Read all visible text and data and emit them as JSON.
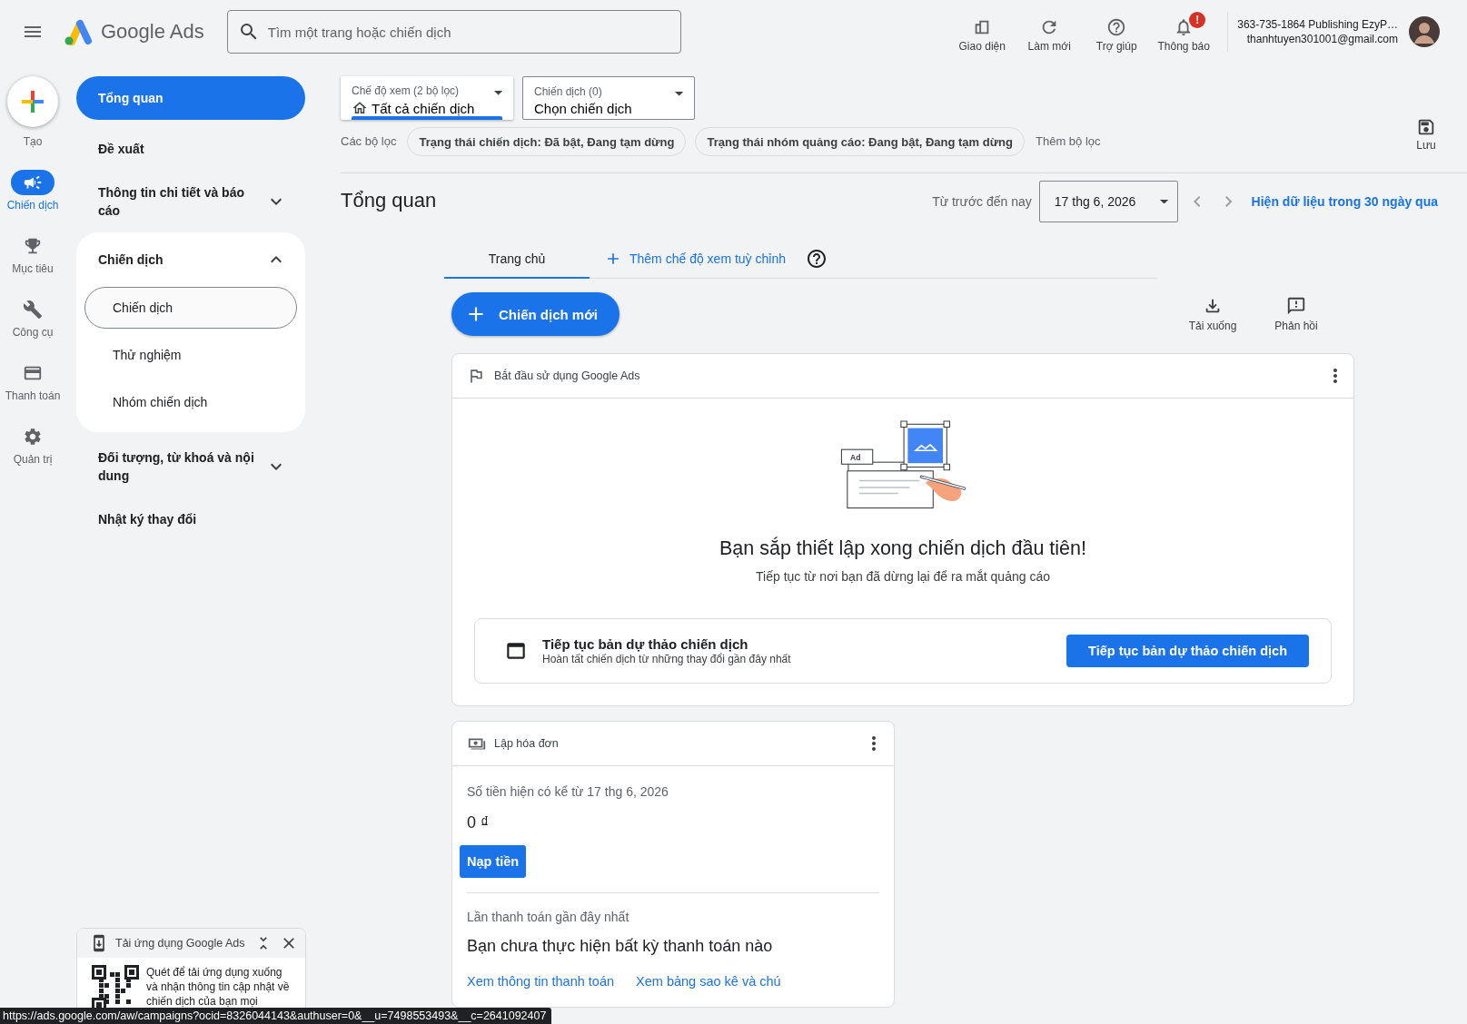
{
  "header": {
    "brand": "Google Ads",
    "search_placeholder": "Tìm một trang hoặc chiến dịch",
    "actions": [
      {
        "kind": "appearance",
        "label": "Giao diện"
      },
      {
        "kind": "refresh",
        "label": "Làm mới"
      },
      {
        "kind": "help",
        "label": "Trợ giúp"
      },
      {
        "kind": "notifications",
        "label": "Thông báo",
        "badge": "!"
      }
    ],
    "account": {
      "name": "363-735-1864 Publishing EzyP…",
      "email": "thanhtuyen301001@gmail.com"
    }
  },
  "rail": {
    "create": "Tạo",
    "items": [
      {
        "kind": "campaigns",
        "label": "Chiến dịch",
        "selected": true
      },
      {
        "kind": "goals",
        "label": "Mục tiêu",
        "selected": false
      },
      {
        "kind": "tools",
        "label": "Công cụ",
        "selected": false
      },
      {
        "kind": "billing",
        "label": "Thanh toán",
        "selected": false
      },
      {
        "kind": "admin",
        "label": "Quản trị",
        "selected": false
      }
    ]
  },
  "sidebar": {
    "items": [
      {
        "label": "Tổng quan",
        "selected": true
      },
      {
        "label": "Đề xuất",
        "selected": false
      },
      {
        "label": "Thông tin chi tiết và báo cáo",
        "selected": false,
        "expanded": false
      },
      {
        "label": "Chiến dịch",
        "selected": false,
        "expanded": true,
        "children": [
          {
            "label": "Chiến dịch",
            "hovered": true
          },
          {
            "label": "Thử nghiệm",
            "hovered": false
          },
          {
            "label": "Nhóm chiến dịch",
            "hovered": false
          }
        ]
      },
      {
        "label": "Đối tượng, từ khoá và nội dung",
        "selected": false,
        "expanded": false
      },
      {
        "label": "Nhật ký thay đổi",
        "selected": false
      }
    ]
  },
  "selectors": [
    {
      "kind": "view",
      "label": "Chế độ xem (2 bộ lọc)",
      "value": "Tất cả chiến dịch"
    },
    {
      "kind": "campaign",
      "label": "Chiến dịch (0)",
      "value": "Chọn chiến dịch"
    }
  ],
  "filters": {
    "label": "Các bộ lọc",
    "chips": [
      "Trạng thái chiến dịch: Đã bật, Đang tạm dừng",
      "Trạng thái nhóm quảng cáo: Đang bật, Đang tạm dừng"
    ],
    "add": "Thêm bộ lọc",
    "save": "Lưu"
  },
  "page_title": "Tổng quan",
  "date_range": {
    "label": "Từ trước đến nay",
    "value": "17 thg 6, 2026",
    "link": "Hiện dữ liệu trong 30 ngày qua"
  },
  "tabs": [
    {
      "kind": "view",
      "label": "Trang chủ",
      "selected": true
    },
    {
      "kind": "add",
      "label": "Thêm chế độ xem tuỳ chỉnh",
      "selected": false
    }
  ],
  "new_campaign": "Chiến dịch mới",
  "tools": [
    {
      "kind": "download",
      "label": "Tải xuống"
    },
    {
      "kind": "feedback",
      "label": "Phản hồi"
    }
  ],
  "setup_card": {
    "title": "Bắt đầu sử dụng Google Ads",
    "ad_label": "Ad",
    "heading": "Bạn sắp thiết lập xong chiến dịch đầu tiên!",
    "subheading": "Tiếp tục từ nơi bạn đã dừng lại để ra mắt quảng cáo",
    "draft": {
      "title": "Tiếp tục bản dự thảo chiến dịch",
      "description": "Hoàn tất chiến dịch từ những thay đổi gần đây nhất",
      "button": "Tiếp tục bản dự thảo chiến dịch"
    }
  },
  "billing_card": {
    "title": "Lập hóa đơn",
    "balance_label": "Số tiền hiện có kể từ 17 thg 6, 2026",
    "balance": "0 ₫",
    "button": "Nạp tiền",
    "last_payment_label": "Lần thanh toán gần đây nhất",
    "last_payment": "Bạn chưa thực hiện bất kỳ thanh toán nào",
    "links": [
      "Xem thông tin thanh toán",
      "Xem bảng sao kê và chú"
    ]
  },
  "app_promo": {
    "title": "Tải ứng dụng Google Ads",
    "text": "Quét để tải ứng dụng xuống và nhận thông tin cập nhật về chiến dịch của bạn mọi"
  },
  "status_url": "https://ads.google.com/aw/campaigns?ocid=8326044143&authuser=0&__u=7498553493&__c=2641092407"
}
